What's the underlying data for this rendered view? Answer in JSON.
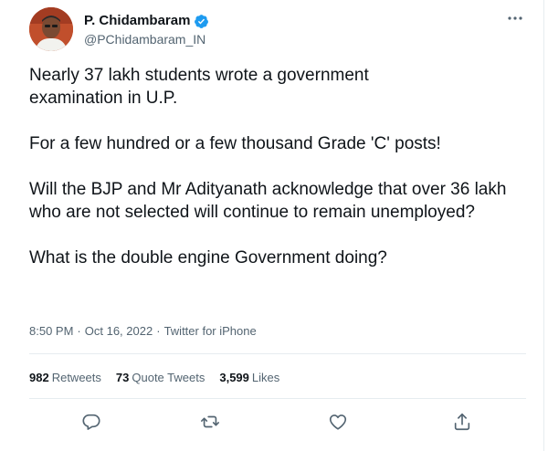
{
  "author": {
    "display_name": "P. Chidambaram",
    "handle": "@PChidambaram_IN",
    "verified": true
  },
  "tweet": {
    "paragraphs": [
      "Nearly 37 lakh students wrote a government examination in U.P.",
      "For a few hundred or a few thousand Grade 'C' posts!",
      "Will the BJP and Mr Adityanath acknowledge that over 36 lakh who are not selected will continue to remain unemployed?",
      "What is the double engine Government doing?"
    ],
    "time": "8:50 PM",
    "date": "Oct 16, 2022",
    "source": "Twitter for iPhone",
    "separator": "·"
  },
  "stats": {
    "retweets": {
      "count": "982",
      "label": "Retweets"
    },
    "quotes": {
      "count": "73",
      "label": "Quote Tweets"
    },
    "likes": {
      "count": "3,599",
      "label": "Likes"
    }
  },
  "icons": {
    "more": "more-horizontal-icon",
    "reply": "reply-icon",
    "retweet": "retweet-icon",
    "like": "heart-icon",
    "share": "share-icon",
    "verified": "verified-badge-icon"
  },
  "colors": {
    "text": "#0f1419",
    "secondary": "#536471",
    "verified": "#1d9bf0",
    "divider": "#e6ecf0"
  }
}
